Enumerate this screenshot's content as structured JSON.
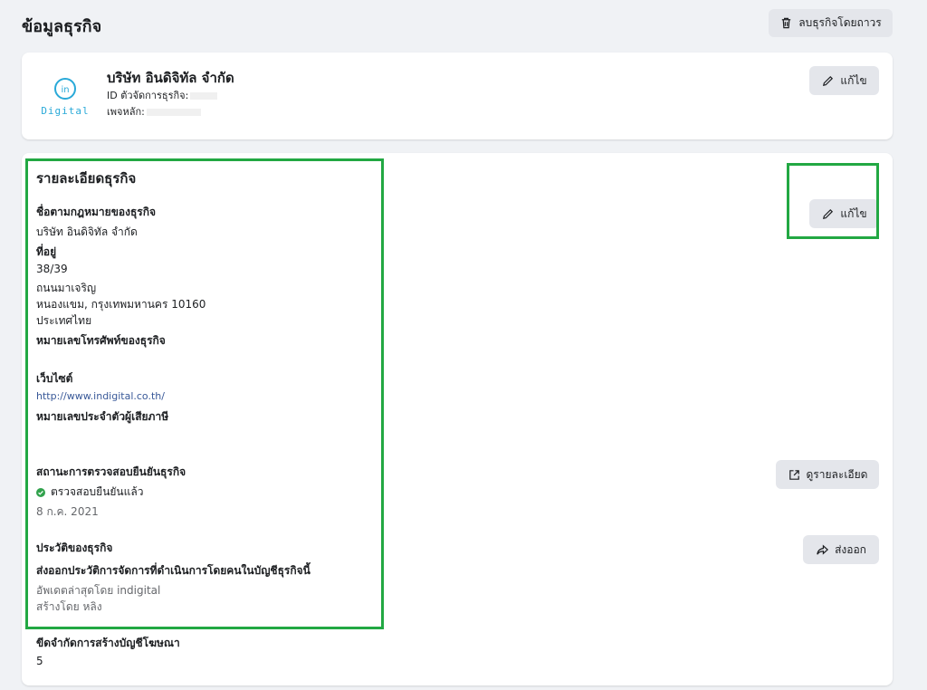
{
  "page": {
    "title": "ข้อมูลธุรกิจ"
  },
  "delete_button": {
    "label": "ลบธุรกิจโดยถาวร",
    "icon": "trash-icon"
  },
  "business": {
    "logo_text": "Digital",
    "name": "บริษัท อินดิจิทัล จำกัด",
    "id_label": "ID ตัวจัดการธุรกิจ:",
    "page_label": "เพจหลัก:",
    "edit_label": "แก้ไข"
  },
  "details": {
    "title": "รายละเอียดธุรกิจ",
    "edit_label": "แก้ไข",
    "legal_name_label": "ชื่อตามกฎหมายของธุรกิจ",
    "legal_name": "บริษัท อินดิจิทัล จำกัด",
    "address_label": "ที่อยู่",
    "address_line1": "38/39",
    "address_line2": "ถนนมาเจริญ",
    "address_line3": "หนองแขม, กรุงเทพมหานคร 10160",
    "address_line4": "ประเทศไทย",
    "phone_label": "หมายเลขโทรศัพท์ของธุรกิจ",
    "website_label": "เว็บไซต์",
    "website": "http://www.indigital.co.th/",
    "tax_label": "หมายเลขประจำตัวผู้เสียภาษี",
    "verify_label": "สถานะการตรวจสอบยืนยันธุรกิจ",
    "verify_status": "ตรวจสอบยืนยันแล้ว",
    "verify_date": "8 ก.ค. 2021",
    "view_details_label": "ดูรายละเอียด",
    "history_label": "ประวัติของธุรกิจ",
    "export_label": "ส่งออก",
    "export_history_label": "ส่งออกประวัติการจัดการที่ดำเนินการโดยคนในบัญชีธุรกิจนี้",
    "updated_by": "อัพเดตล่าสุดโดย indigital",
    "created_by": "สร้างโดย หลิง",
    "ad_limit_label": "ขีดจำกัดการสร้างบัญชีโฆษณา",
    "ad_limit_value": "5"
  },
  "colors": {
    "highlight": "#22a843",
    "verified": "#31a24c",
    "link": "#385898"
  }
}
